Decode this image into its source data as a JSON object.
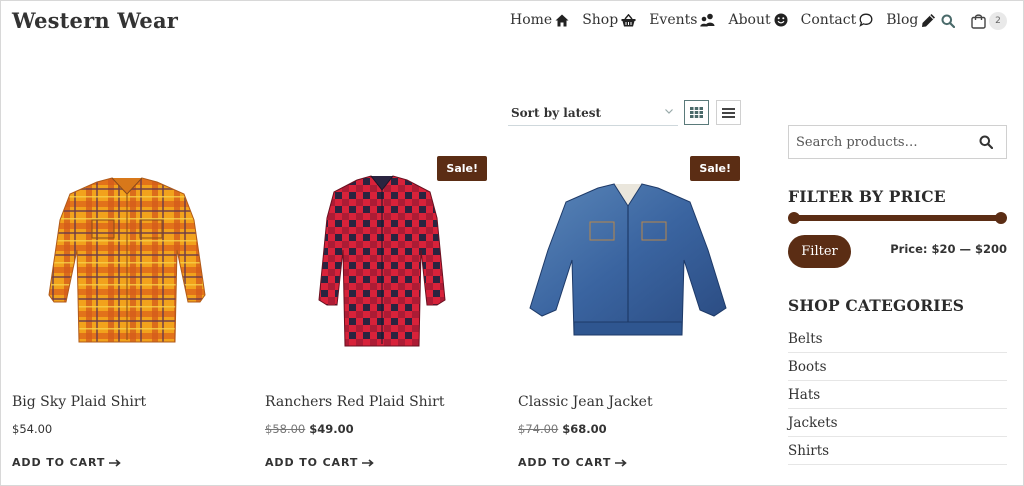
{
  "site": {
    "title": "Western Wear"
  },
  "nav": [
    {
      "label": "Home",
      "icon": "home-icon"
    },
    {
      "label": "Shop",
      "icon": "basket-icon"
    },
    {
      "label": "Events",
      "icon": "people-icon"
    },
    {
      "label": "About",
      "icon": "smiley-icon"
    },
    {
      "label": "Contact",
      "icon": "chat-bubble-icon"
    },
    {
      "label": "Blog",
      "icon": "pencil-icon"
    }
  ],
  "header": {
    "cart_count": "2"
  },
  "toolbar": {
    "sort_label": "Sort by latest"
  },
  "products": [
    {
      "title": "Big Sky Plaid Shirt",
      "price": "$54.00",
      "sale": false,
      "cart_label": "ADD TO CART"
    },
    {
      "title": "Ranchers Red Plaid Shirt",
      "old_price": "$58.00",
      "price": "$49.00",
      "sale": true,
      "sale_label": "Sale!",
      "cart_label": "ADD TO CART"
    },
    {
      "title": "Classic Jean Jacket",
      "old_price": "$74.00",
      "price": "$68.00",
      "sale": true,
      "sale_label": "Sale!",
      "cart_label": "ADD TO CART"
    }
  ],
  "sidebar": {
    "search_placeholder": "Search products…",
    "filter_title": "FILTER BY PRICE",
    "filter_button": "Filter",
    "price_range": "Price: $20 — $200",
    "categories_title": "SHOP CATEGORIES",
    "categories": [
      "Belts",
      "Boots",
      "Hats",
      "Jackets",
      "Shirts"
    ]
  },
  "colors": {
    "accent": "#5b2d14",
    "text": "#333333",
    "border": "#d0d0d0"
  }
}
